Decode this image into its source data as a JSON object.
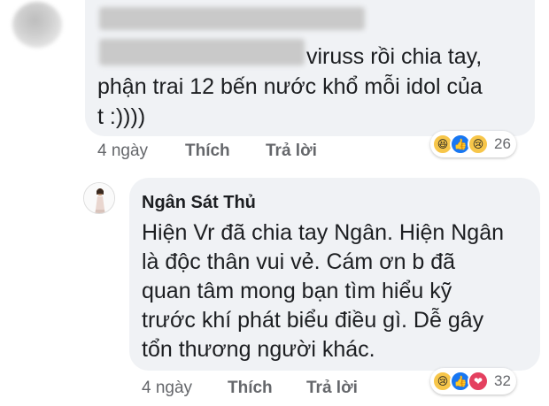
{
  "comment1": {
    "text_lines": [
      "viruss rồi chia tay,",
      "phận trai 12 bến nước khổ mỗi idol của",
      "t :))))"
    ],
    "actions": {
      "time": "4 ngày",
      "like": "Thích",
      "reply": "Trả lời"
    },
    "reactions": {
      "icons": [
        "haha-icon",
        "like-icon",
        "sad-icon"
      ],
      "count": "26"
    }
  },
  "comment2": {
    "author": "Ngân Sát Thủ",
    "text_lines": [
      "Hiện Vr đã chia tay Ngân. Hiện Ngân",
      "là độc thân vui vẻ. Cám ơn b đã",
      "quan tâm mong bạn tìm hiểu kỹ",
      "trước khí phát biểu điều gì. Dễ gây",
      "tổn thương người khác."
    ],
    "actions": {
      "time": "4 ngày",
      "like": "Thích",
      "reply": "Trả lời"
    },
    "reactions": {
      "icons": [
        "sad-icon",
        "like-icon",
        "love-icon"
      ],
      "count": "32"
    }
  },
  "colors": {
    "bubble": "#f0f2f5",
    "meta_text": "#65676b",
    "like_blue": "#1877f2",
    "love_red": "#e4405f",
    "emoji_yellow": "#f7c64a"
  }
}
